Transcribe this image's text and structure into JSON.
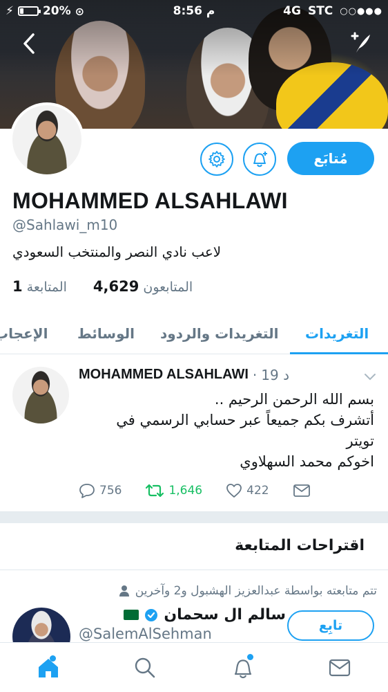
{
  "status_bar": {
    "battery": "20%",
    "battery_level": 0.2,
    "time": "8:56 م",
    "network": "4G",
    "carrier": "STC"
  },
  "profile": {
    "name": "MOHAMMED ALSAHLAWI",
    "handle": "@Sahlawi_m10",
    "bio": "لاعب نادي النصر والمنتخب السعودي",
    "followers_count": "4,629",
    "followers_label": "المتابعون",
    "following_count": "1",
    "following_label": "المتابعة",
    "follow_button": "مُتابَع"
  },
  "tabs": [
    {
      "label": "التغريدات",
      "active": true
    },
    {
      "label": "التغريدات والردود",
      "active": false
    },
    {
      "label": "الوسائط",
      "active": false
    },
    {
      "label": "الإعجاب",
      "active": false
    }
  ],
  "tweet": {
    "author": "MOHAMMED ALSAHLAWI",
    "time": "19 د",
    "lines": [
      "بسم الله الرحمن الرحيم ..",
      "أتشرف بكم جميعاً عبر حسابي الرسمي في",
      "تويتر",
      "اخوكم محمد السهلاوي"
    ],
    "replies": "756",
    "retweets": "1,646",
    "likes": "422"
  },
  "suggestions": {
    "title": "اقتراحات المتابعة",
    "followed_by": "تتم متابعته بواسطة عبدالعزيز الهشبول و2 وآخرين",
    "user_name": "سالم ال سحمان",
    "user_handle": "@SalemAlSehman",
    "follow_label": "تابِع"
  },
  "colors": {
    "accent": "#1da1f2",
    "retweet": "#17bf63",
    "muted": "#657786"
  },
  "icons": [
    "back-icon",
    "compose-icon",
    "gear-icon",
    "bell-plus-icon",
    "chevron-down-icon",
    "reply-icon",
    "retweet-icon",
    "like-icon",
    "dm-icon",
    "verified-icon",
    "person-icon",
    "home-icon",
    "search-icon",
    "notifications-icon",
    "messages-icon"
  ]
}
